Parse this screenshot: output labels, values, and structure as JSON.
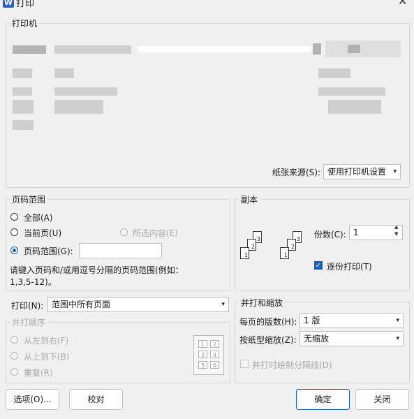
{
  "window": {
    "title": "打印",
    "app_icon_letter": "W",
    "close_glyph": "✕"
  },
  "printer": {
    "legend": "打印机",
    "paper_source_label": "纸张来源(S):",
    "paper_source_value": "使用打印机设置"
  },
  "page_range": {
    "legend": "页码范围",
    "all": "全部(A)",
    "current": "当前页(U)",
    "selection": "所选内容(E)",
    "pages": "页码范围(G):",
    "pages_value": "",
    "hint_line1": "请键入页码和/或用逗号分隔的页码范围(例如：",
    "hint_line2": "1,3,5-12)。"
  },
  "print_what": {
    "label": "打印(N):",
    "value": "范围中所有页面"
  },
  "collate_order": {
    "legend": "并打顺序",
    "left_to_right": "从左到右(F)",
    "top_to_bottom": "从上到下(B)",
    "repeat": "重复(R)",
    "cells": [
      "1",
      "2",
      "3",
      "4",
      "5",
      "6"
    ]
  },
  "copies": {
    "legend": "副本",
    "count_label": "份数(C):",
    "count_value": "1",
    "collate": "逐份打印(T)",
    "collate_checked": true,
    "stack_a": [
      "1",
      "2",
      "3"
    ],
    "stack_b": [
      "1",
      "2",
      "3"
    ]
  },
  "zoom": {
    "legend": "并打和缩放",
    "pages_per_sheet_label": "每页的版数(H):",
    "pages_per_sheet_value": "1 版",
    "scale_label": "按纸型缩放(Z):",
    "scale_value": "无缩放",
    "draw_borders": "并打时绘制分隔线(D)"
  },
  "buttons": {
    "options": "选项(O)...",
    "proofread": "校对",
    "ok": "确定",
    "close": "关闭"
  },
  "icons": {
    "dropdown": "▾",
    "spin_up": "▲",
    "spin_down": "▼",
    "check": "✓"
  },
  "colors": {
    "accent": "#1a5fb4",
    "background": "#f0f0f0"
  }
}
